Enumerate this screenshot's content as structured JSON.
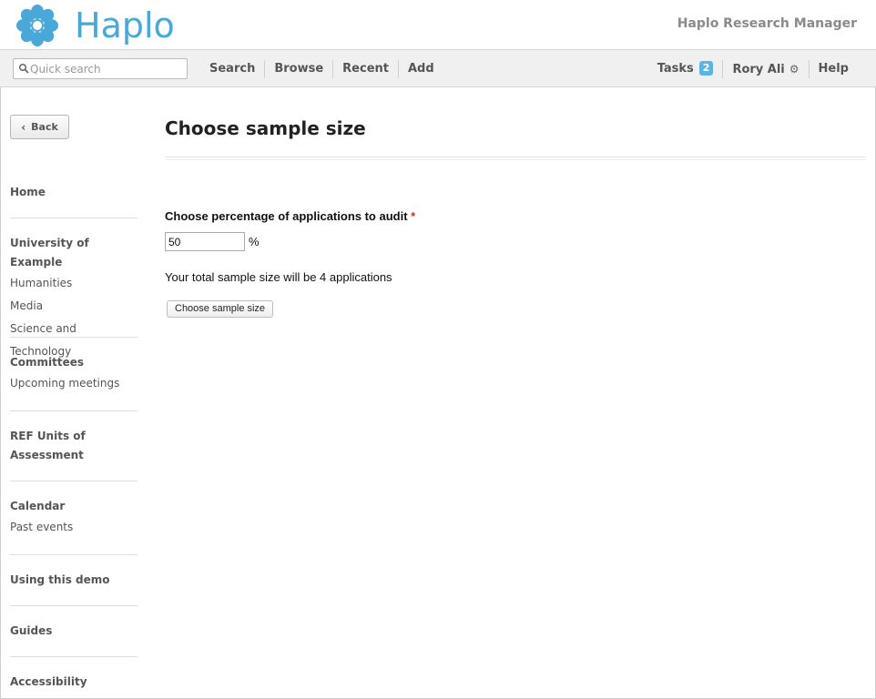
{
  "header": {
    "logo_text": "Haplo",
    "app_name": "Haplo Research Manager",
    "brand_color": "#4aa8d8"
  },
  "navbar": {
    "search_placeholder": "Quick search",
    "items": [
      "Search",
      "Browse",
      "Recent",
      "Add"
    ],
    "tasks_label": "Tasks",
    "tasks_count": "2",
    "user_name": "Rory Ali",
    "help_label": "Help"
  },
  "sidebar": {
    "back_label": "Back",
    "home": "Home",
    "university": "University of Example",
    "university_links": [
      "Humanities",
      "Media",
      "Science and Technology"
    ],
    "committees": "Committees",
    "committees_links": [
      "Upcoming meetings"
    ],
    "ref_units_line1": "REF Units of",
    "ref_units_line2": "Assessment",
    "calendar": "Calendar",
    "calendar_links": [
      "Past events"
    ],
    "using_demo": "Using this demo",
    "guides": "Guides",
    "accessibility": "Accessibility"
  },
  "main": {
    "title": "Choose sample size",
    "field_label": "Choose percentage of applications to audit",
    "required_mark": "*",
    "percentage_value": "50",
    "percent_sign": "%",
    "total_text": "Your total sample size will be 4 applications",
    "submit_label": "Choose sample size"
  }
}
